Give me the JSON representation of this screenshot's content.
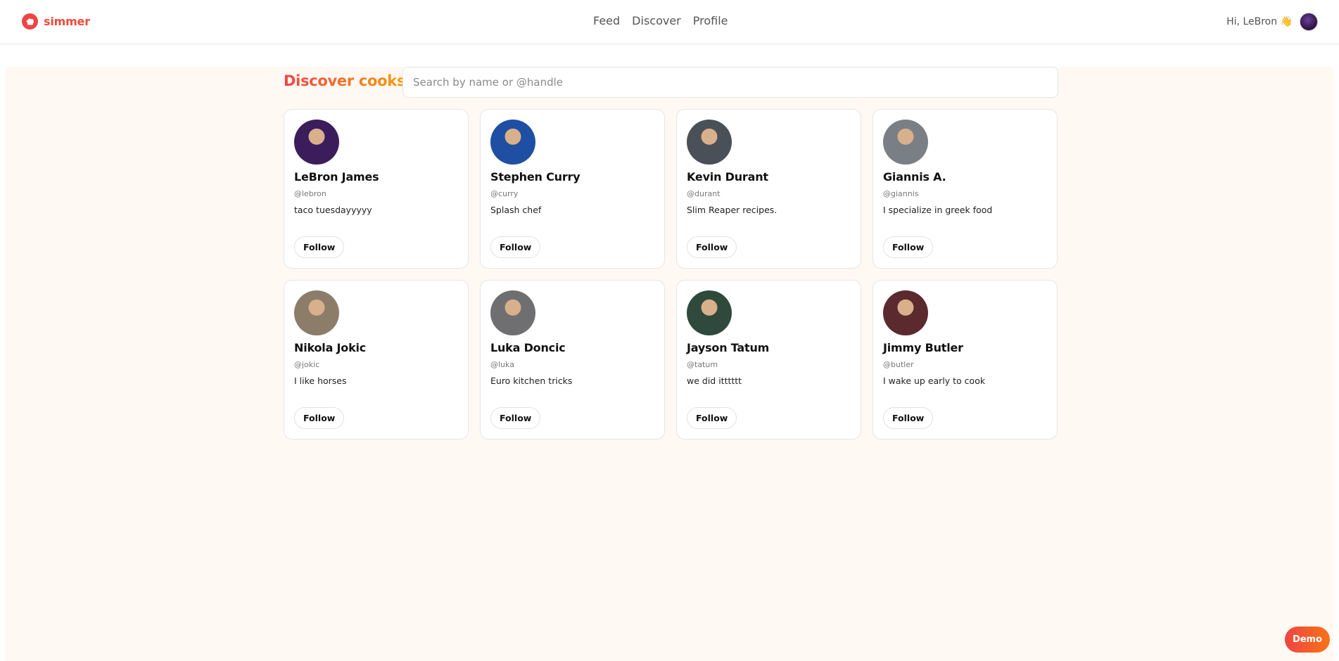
{
  "header": {
    "brand": "simmer",
    "nav": [
      {
        "label": "Feed"
      },
      {
        "label": "Discover"
      },
      {
        "label": "Profile"
      }
    ],
    "greeting": "Hi, LeBron 👋"
  },
  "discover": {
    "title": "Discover cooks",
    "search_placeholder": "Search by name or @handle",
    "search_value": ""
  },
  "cooks": [
    {
      "name": "LeBron James",
      "handle": "@lebron",
      "bio": "taco tuesdayyyyy",
      "follow": "Follow",
      "avatar_color": "#3b1d5c"
    },
    {
      "name": "Stephen Curry",
      "handle": "@curry",
      "bio": "Splash chef",
      "follow": "Follow",
      "avatar_color": "#1e4fa3"
    },
    {
      "name": "Kevin Durant",
      "handle": "@durant",
      "bio": "Slim Reaper recipes.",
      "follow": "Follow",
      "avatar_color": "#4a5058"
    },
    {
      "name": "Giannis A.",
      "handle": "@giannis",
      "bio": "I specialize in greek food",
      "follow": "Follow",
      "avatar_color": "#7a7f86"
    },
    {
      "name": "Nikola Jokic",
      "handle": "@jokic",
      "bio": "I like horses",
      "follow": "Follow",
      "avatar_color": "#8c7d6a"
    },
    {
      "name": "Luka Doncic",
      "handle": "@luka",
      "bio": "Euro kitchen tricks",
      "follow": "Follow",
      "avatar_color": "#6f6f72"
    },
    {
      "name": "Jayson Tatum",
      "handle": "@tatum",
      "bio": "we did itttttt",
      "follow": "Follow",
      "avatar_color": "#2f4a3c"
    },
    {
      "name": "Jimmy Butler",
      "handle": "@butler",
      "bio": "I wake up early to cook",
      "follow": "Follow",
      "avatar_color": "#5b2a2f"
    }
  ],
  "demo_button": "Demo",
  "colors": {
    "accent_red": "#ef4444",
    "accent_orange": "#f97316",
    "page_bg": "#fff8f3"
  }
}
